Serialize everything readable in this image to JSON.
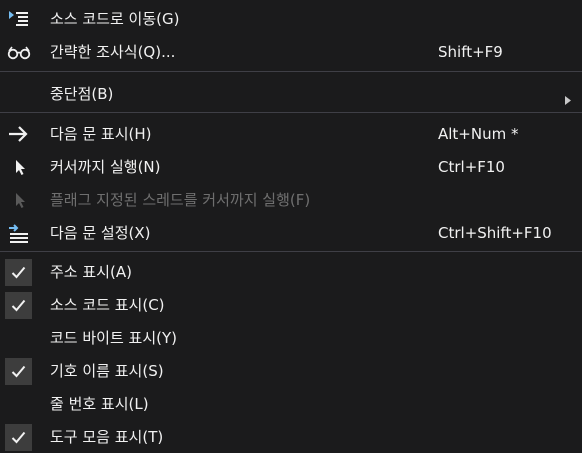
{
  "menu": {
    "items": [
      {
        "label": "소스 코드로 이동(G)",
        "shortcut": "",
        "icon": "goto-source-icon"
      },
      {
        "label": "간략한 조사식(Q)...",
        "shortcut": "Shift+F9",
        "icon": "glasses-icon"
      },
      {
        "label": "중단점(B)",
        "shortcut": "",
        "icon": "",
        "submenu": true
      },
      {
        "label": "다음 문 표시(H)",
        "shortcut": "Alt+Num *",
        "icon": "arrow-right-icon"
      },
      {
        "label": "커서까지 실행(N)",
        "shortcut": "Ctrl+F10",
        "icon": "cursor-icon"
      },
      {
        "label": "플래그 지정된 스레드를 커서까지 실행(F)",
        "shortcut": "",
        "icon": "cursor-icon",
        "disabled": true
      },
      {
        "label": "다음 문 설정(X)",
        "shortcut": "Ctrl+Shift+F10",
        "icon": "set-next-statement-icon"
      },
      {
        "label": "주소 표시(A)",
        "shortcut": "",
        "checked": true
      },
      {
        "label": "소스 코드 표시(C)",
        "shortcut": "",
        "checked": true
      },
      {
        "label": "코드 바이트 표시(Y)",
        "shortcut": "",
        "checked": false
      },
      {
        "label": "기호 이름 표시(S)",
        "shortcut": "",
        "checked": true
      },
      {
        "label": "줄 번호 표시(L)",
        "shortcut": "",
        "checked": false
      },
      {
        "label": "도구 모음 표시(T)",
        "shortcut": "",
        "checked": true
      }
    ]
  },
  "colors": {
    "background": "#1b1b1c",
    "text": "#f1f1f1",
    "disabled_text": "#6f6f6f",
    "separator": "#3f3f46",
    "check_bg": "#3d3d3d",
    "icon_blue": "#75bdf2"
  }
}
